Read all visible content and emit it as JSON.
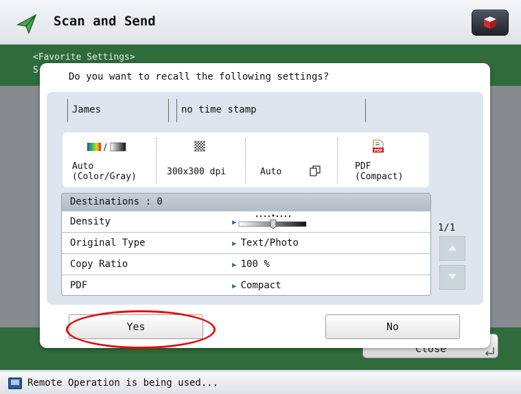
{
  "header": {
    "title": "Scan and Send",
    "app_icon": "scan-send-icon",
    "right_icon": "counter-check-icon"
  },
  "background": {
    "favorites_label": "<Favorite Settings>",
    "partial_letter": "S",
    "close_label": "Close"
  },
  "dialog": {
    "question": "Do you want to recall the following settings?",
    "name_field": "James",
    "stamp_field": "no time stamp",
    "settings": {
      "color": {
        "line1": "Auto",
        "line2": "(Color/Gray)",
        "icon": "color-gray-icon"
      },
      "resolution": {
        "value": "300x300 dpi",
        "icon": "resolution-icon"
      },
      "size": {
        "value": "Auto",
        "icon": "paper-size-icon"
      },
      "format": {
        "line1": "PDF",
        "line2": "(Compact)",
        "icon": "pdf-icon"
      }
    },
    "destinations_label": "Destinations   : 0",
    "rows": [
      {
        "label": "Density",
        "value": ""
      },
      {
        "label": "Original Type",
        "value": "Text/Photo"
      },
      {
        "label": "Copy Ratio",
        "value": "100 %"
      },
      {
        "label": "PDF",
        "value": "Compact"
      }
    ],
    "page_indicator": "1/1",
    "yes_label": "Yes",
    "no_label": "No"
  },
  "status": {
    "text": "Remote Operation is being used...",
    "icon": "remote-screen-icon"
  },
  "colors": {
    "green_band": "#2f6b3b",
    "dim_overlay": "#878b90",
    "annotation_red": "#e01010"
  }
}
